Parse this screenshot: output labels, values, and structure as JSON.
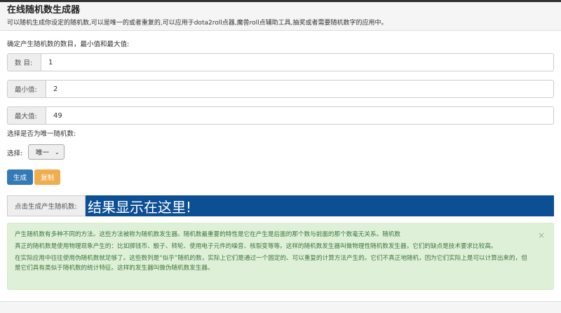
{
  "header": {
    "title": "在线随机数生成器",
    "subtitle": "可以随机生成你设定的随机数,可以是唯一的或者重复的,可以应用于dota2roll点器,魔兽roll点辅助工具,抽奖或者需要随机数字的应用中。"
  },
  "form": {
    "intro": "确定产生随机数的数目，最小值和最大值:",
    "count": {
      "label": "数 目:",
      "value": "1"
    },
    "min": {
      "label": "最小值:",
      "value": "2"
    },
    "max": {
      "label": "最大值:",
      "value": "49"
    },
    "unique_prompt": "选择是否为唯一随机数:",
    "select_label": "选择:",
    "select_value": "唯一"
  },
  "buttons": {
    "generate": "生成",
    "copy": "复制",
    "generate_color": "#337ab7",
    "copy_color": "#f0ad4e"
  },
  "result": {
    "label": "点击生成产生随机数:",
    "value": "结果显示在这里!"
  },
  "alert": {
    "close": "×",
    "paragraphs": [
      "产生随机数有多种不同的方法。这些方法被称为随机数发生器。随机数最重要的特性是它在产生是后面的那个数与前面的那个数毫无关系。随机数",
      "真正的随机数是使用物理现象产生的：比如掷钱币、骰子、转轮、使用电子元件的噪音、核裂变等等。这样的随机数发生器叫做物理性随机数发生器，它们的缺点是技术要求比较高。",
      "在实际应用中往往使用伪随机数就足够了。这些数列是“似乎”随机的数，实际上它们是通过一个固定的、可以重复的计算方法产生的。它们不真正地随机，因为它们实际上是可以计算出来的，但是它们具有类似于随机数的统计特征。这样的发生器叫做伪随机数发生器。"
    ]
  }
}
